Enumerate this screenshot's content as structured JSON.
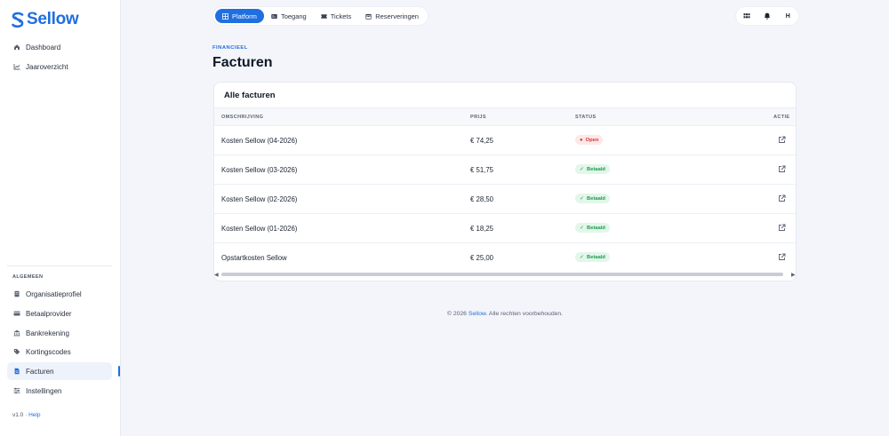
{
  "brand": {
    "name": "Sellow",
    "color": "#1f6fe0"
  },
  "sidebar": {
    "main_items": [
      {
        "label": "Dashboard",
        "icon": "home-icon"
      },
      {
        "label": "Jaaroverzicht",
        "icon": "chart-line-icon"
      }
    ],
    "section_label": "ALGEMEEN",
    "settings_items": [
      {
        "label": "Organisatieprofiel",
        "icon": "document-icon"
      },
      {
        "label": "Betaalprovider",
        "icon": "credit-card-icon"
      },
      {
        "label": "Bankrekening",
        "icon": "bank-icon"
      },
      {
        "label": "Kortingscodes",
        "icon": "tag-icon"
      },
      {
        "label": "Facturen",
        "icon": "invoice-icon",
        "active": true
      },
      {
        "label": "Instellingen",
        "icon": "sliders-icon"
      }
    ],
    "version": "v1.0 ·",
    "help_link": "Help"
  },
  "topnav": {
    "tabs": [
      {
        "label": "Platform",
        "icon": "grid-icon",
        "active": true
      },
      {
        "label": "Toegang",
        "icon": "id-card-icon"
      },
      {
        "label": "Tickets",
        "icon": "ticket-icon"
      },
      {
        "label": "Reserveringen",
        "icon": "calendar-icon"
      }
    ],
    "avatar_initial": "H"
  },
  "page": {
    "eyebrow": "FINANCIEEL",
    "title": "Facturen"
  },
  "invoices": {
    "card_title": "Alle facturen",
    "columns": [
      "OMSCHRIJVING",
      "PRIJS",
      "STATUS",
      "ACTIE"
    ],
    "rows": [
      {
        "description": "Kosten Sellow (04-2026)",
        "price": "€ 74,25",
        "status": "Open",
        "status_type": "open"
      },
      {
        "description": "Kosten Sellow (03-2026)",
        "price": "€ 51,75",
        "status": "Betaald",
        "status_type": "paid"
      },
      {
        "description": "Kosten Sellow (02-2026)",
        "price": "€ 28,50",
        "status": "Betaald",
        "status_type": "paid"
      },
      {
        "description": "Kosten Sellow (01-2026)",
        "price": "€ 18,25",
        "status": "Betaald",
        "status_type": "paid"
      },
      {
        "description": "Opstartkosten Sellow",
        "price": "€ 25,00",
        "status": "Betaald",
        "status_type": "paid"
      }
    ]
  },
  "footer": {
    "prefix": "© 2026",
    "brand_link": "Sellow",
    "suffix": ". Alle rechten voorbehouden."
  }
}
